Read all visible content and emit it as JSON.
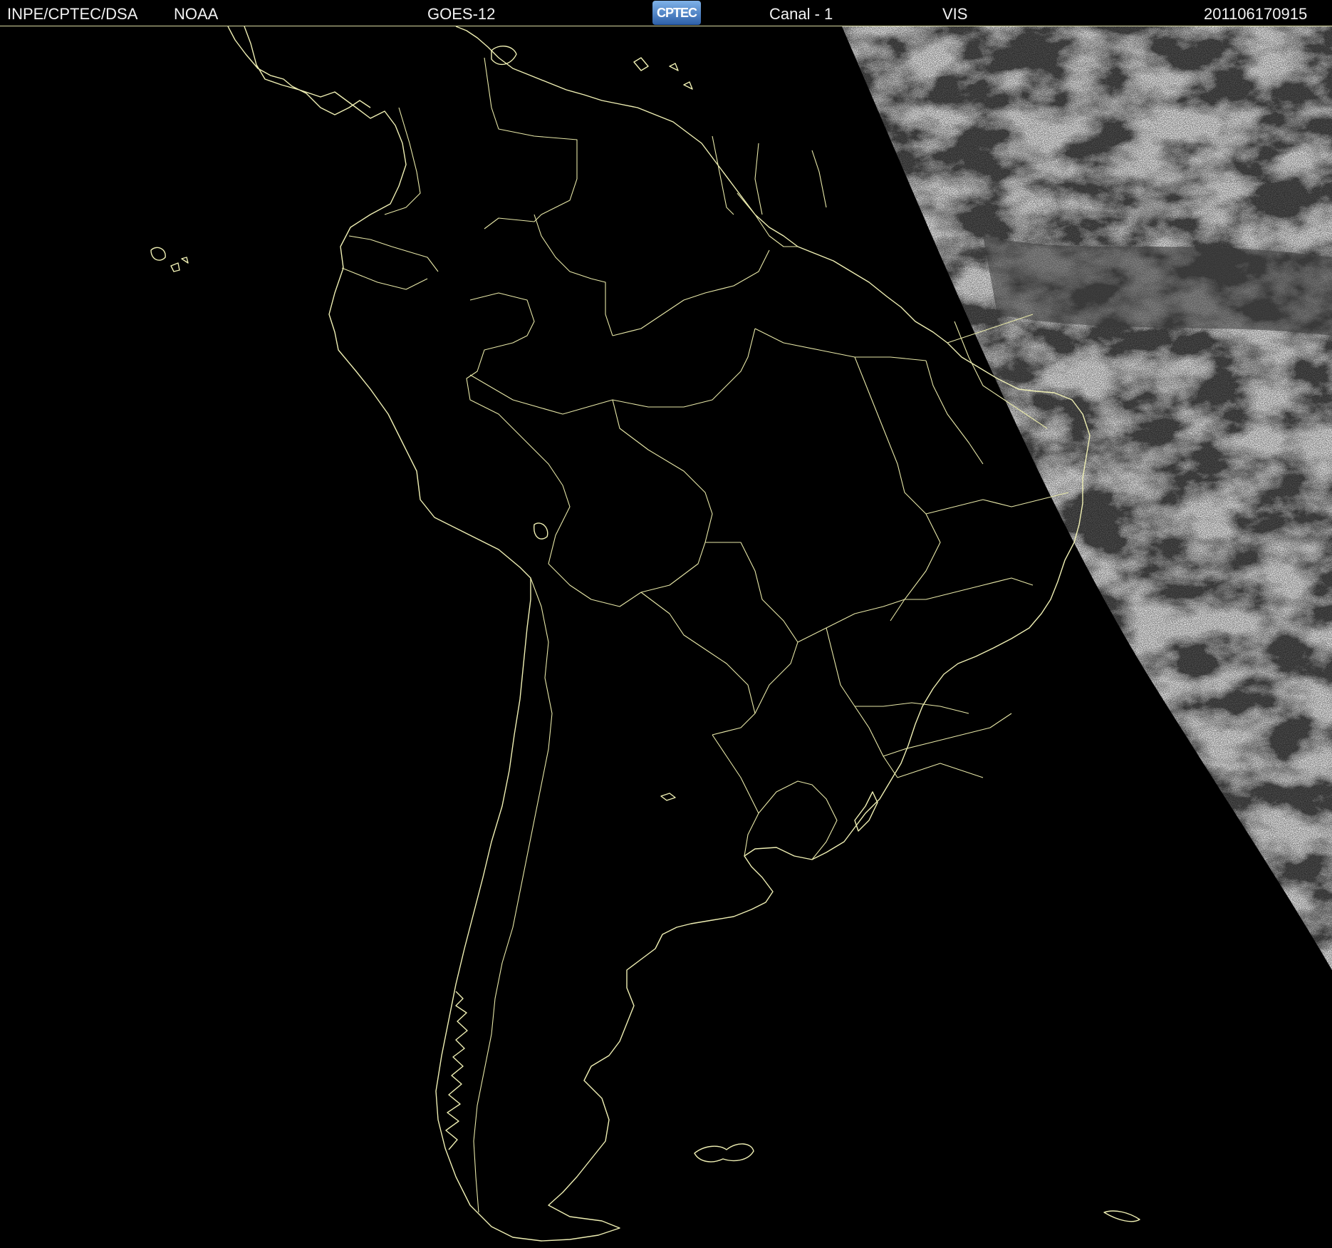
{
  "header": {
    "agency": "INPE/CPTEC/DSA",
    "source": "NOAA",
    "satellite": "GOES-12",
    "logo_text": "CPTEC",
    "channel": "Canal - 1",
    "band": "VIS",
    "datetime": "201106170915"
  },
  "colors": {
    "background": "#000000",
    "outline": "#f0f0b4",
    "cloud_light": "#d8d8d8",
    "cloud_dark": "#4a4a4a"
  },
  "map": {
    "region": "South America",
    "illumination": "day side visible in east (terminator)",
    "icon": "satellite-image"
  }
}
